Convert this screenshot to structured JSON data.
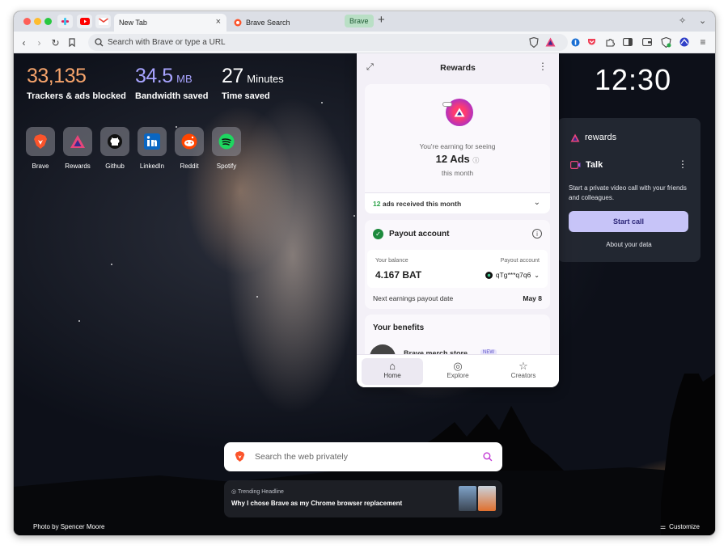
{
  "tabs": {
    "active_title": "New Tab",
    "search_tab_title": "Brave Search",
    "group_label": "Brave"
  },
  "toolbar": {
    "url_placeholder": "Search with Brave or type a URL"
  },
  "stats": {
    "trackers_value": "33,135",
    "trackers_label": "Trackers & ads blocked",
    "bandwidth_value": "34.5",
    "bandwidth_unit": "MB",
    "bandwidth_label": "Bandwidth saved",
    "time_value": "27",
    "time_unit": "Minutes",
    "time_label": "Time saved"
  },
  "top_sites": [
    {
      "name": "Brave"
    },
    {
      "name": "Rewards"
    },
    {
      "name": "Github"
    },
    {
      "name": "LinkedIn"
    },
    {
      "name": "Reddit"
    },
    {
      "name": "Spotify"
    }
  ],
  "clock": "12:30",
  "talk_card": {
    "rewards_label": "rewards",
    "talk_label": "Talk",
    "description": "Start a private video call with your friends and colleagues.",
    "start_call": "Start call",
    "about": "About your data"
  },
  "search": {
    "placeholder": "Search the web privately"
  },
  "news": {
    "kicker": "Trending Headline",
    "headline": "Why I chose Brave as my Chrome browser replacement"
  },
  "credit": "Photo by Spencer Moore",
  "customize": "Customize",
  "rewards_panel": {
    "title": "Rewards",
    "earning_line": "You're earning for seeing",
    "ads_count": "12 Ads",
    "this_month": "this month",
    "received_count": "12",
    "received_text": "ads received this month",
    "payout_title": "Payout account",
    "balance_label": "Your balance",
    "balance_value": "4.167 BAT",
    "payout_label": "Payout account",
    "payout_value": "qTg***q7q6",
    "next_payout_label": "Next earnings payout date",
    "next_payout_date": "May 8",
    "benefits_title": "Your benefits",
    "merch_label": "Brave merch store",
    "merch_badge": "NEW",
    "nav": [
      {
        "label": "Home"
      },
      {
        "label": "Explore"
      },
      {
        "label": "Creators"
      }
    ]
  },
  "colors": {
    "trackers": "#f5a36b",
    "bandwidth": "#a8a4ff",
    "brave_orange": "#fb542b",
    "start_call_bg": "#c7c4f8",
    "received_green": "#2ba248"
  }
}
